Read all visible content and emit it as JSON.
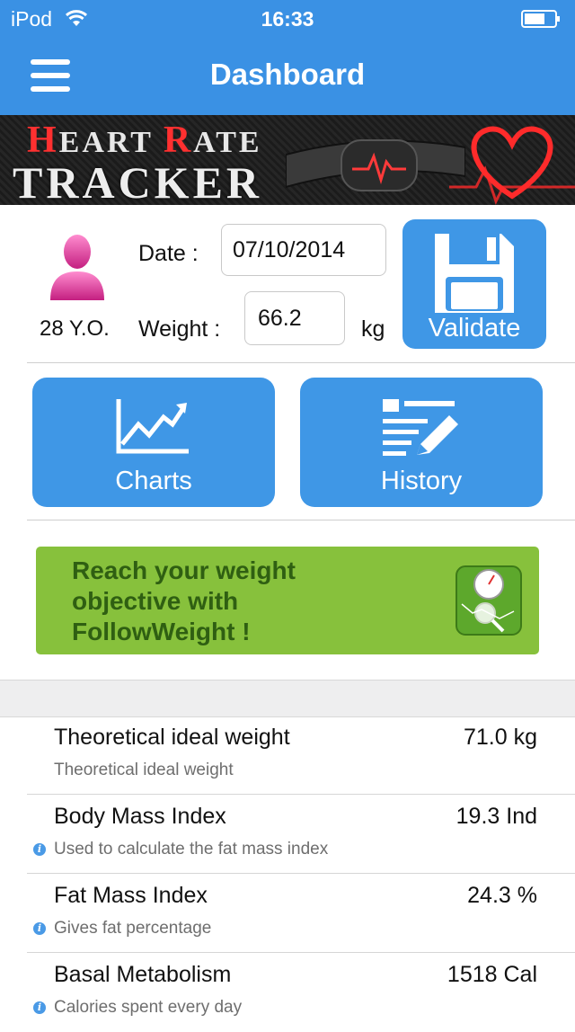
{
  "status_bar": {
    "carrier": "iPod",
    "time": "16:33"
  },
  "nav": {
    "title": "Dashboard"
  },
  "banner": {
    "line1_first": "H",
    "line1_rest_a": "EART ",
    "line1_r": "R",
    "line1_rest_b": "ATE",
    "line2": "TRACKER"
  },
  "profile": {
    "age": "28 Y.O.",
    "date_label": "Date :",
    "date_value": "07/10/2014",
    "weight_label": "Weight :",
    "weight_value": "66.2",
    "unit": "kg",
    "validate_label": "Validate"
  },
  "buttons": {
    "charts": "Charts",
    "history": "History"
  },
  "promo": {
    "text": "Reach your weight objective with FollowWeight !"
  },
  "stats": [
    {
      "name": "Theoretical ideal weight",
      "value": "71.0 kg",
      "desc": "Theoretical ideal weight",
      "info": false
    },
    {
      "name": "Body Mass Index",
      "value": "19.3 Ind",
      "desc": "Used to calculate the fat mass index",
      "info": true
    },
    {
      "name": "Fat Mass Index",
      "value": "24.3 %",
      "desc": "Gives fat percentage",
      "info": true
    },
    {
      "name": "Basal Metabolism",
      "value": "1518 Cal",
      "desc": "Calories spent every day",
      "info": true
    }
  ],
  "colors": {
    "primary": "#3a91e4",
    "button": "#3f97e6",
    "promo": "#87c13c",
    "promo_text": "#2f5f12",
    "avatar": "#e0409a"
  }
}
